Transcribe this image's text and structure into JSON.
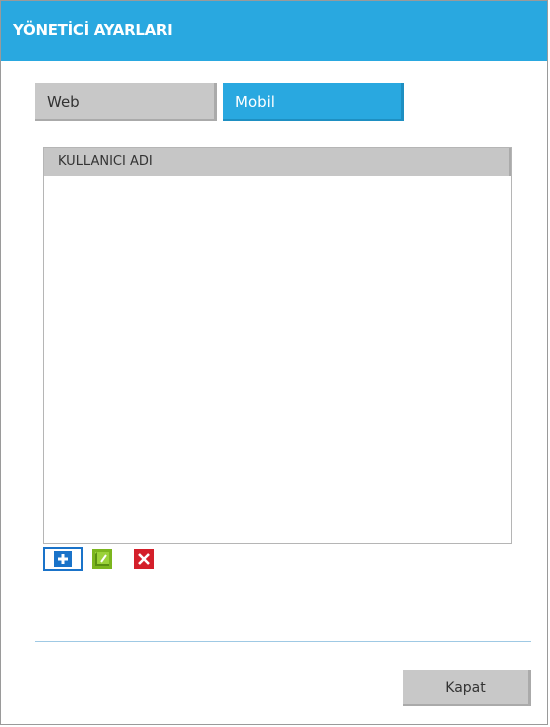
{
  "window": {
    "title": "YÖNETİCİ AYARLARI"
  },
  "tabs": {
    "web": "Web",
    "mobil": "Mobil",
    "active": "Mobil"
  },
  "grid": {
    "columns": [
      "KULLANICI ADI"
    ],
    "rows": []
  },
  "actions": {
    "add_icon": "plus-icon",
    "edit_icon": "edit-icon",
    "delete_icon": "close-x-icon"
  },
  "footer": {
    "close_label": "Kapat"
  },
  "colors": {
    "accent": "#29a8e0",
    "add": "#1a73c9",
    "edit": "#7cb61e",
    "delete": "#d41f2a",
    "neutral": "#c8c8c8"
  }
}
